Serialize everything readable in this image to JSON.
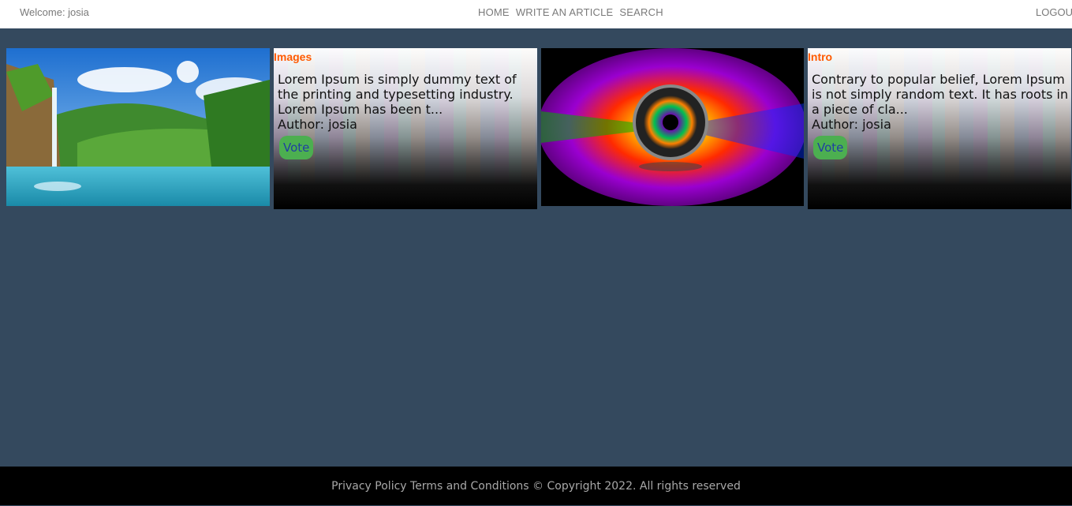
{
  "header": {
    "welcome": "Welcome: josia",
    "nav": [
      "HOME",
      "WRITE AN ARTICLE",
      "SEARCH"
    ],
    "logout": "LOGOUT"
  },
  "articles": [
    {
      "image_name": "waterfall-landscape-image",
      "category": "Images",
      "excerpt": "Lorem Ipsum is simply dummy text of the printing and typesetting industry. Lorem Ipsum has been t...",
      "author": "Author: josia",
      "vote_label": "Vote"
    },
    {
      "image_name": "camera-lens-image",
      "category": "Intro",
      "excerpt": "Contrary to popular belief, Lorem Ipsum is not simply random text. It has roots in a piece of cla...",
      "author": "Author: josia",
      "vote_label": "Vote"
    }
  ],
  "footer": {
    "text": "Privacy Policy Terms and Conditions © Copyright 2022. All rights reserved"
  }
}
